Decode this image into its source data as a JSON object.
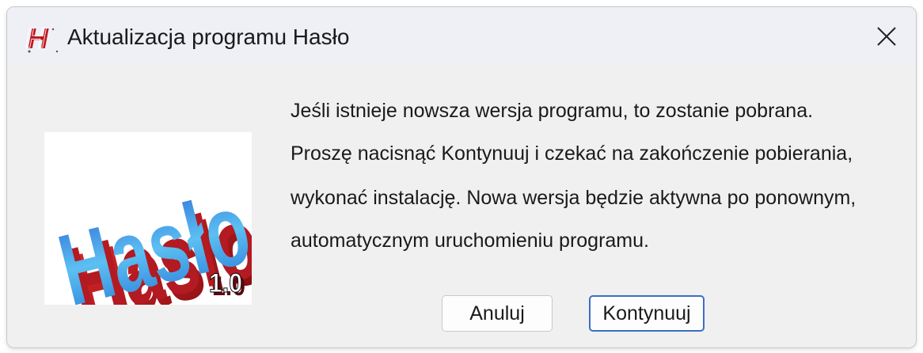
{
  "window": {
    "title": "Aktualizacja programu Hasło"
  },
  "logo": {
    "text": "Hasło",
    "version": "1.0"
  },
  "message": {
    "lines": [
      "Jeśli istnieje nowsza wersja programu, to zostanie pobrana.",
      "Proszę nacisnąć Kontynuuj i czekać na zakończenie pobierania,",
      "wykonać instalację. Nowa wersja będzie aktywna po ponownym,",
      "automatycznym uruchomieniu programu."
    ]
  },
  "buttons": {
    "cancel_label": "Anuluj",
    "continue_label": "Kontynuuj"
  },
  "colors": {
    "accent": "#3a6fc4",
    "logo_blue": "#3aa0e8",
    "logo_red": "#c0141c"
  },
  "icons": {
    "app": "app-h-icon",
    "close": "close-icon"
  }
}
